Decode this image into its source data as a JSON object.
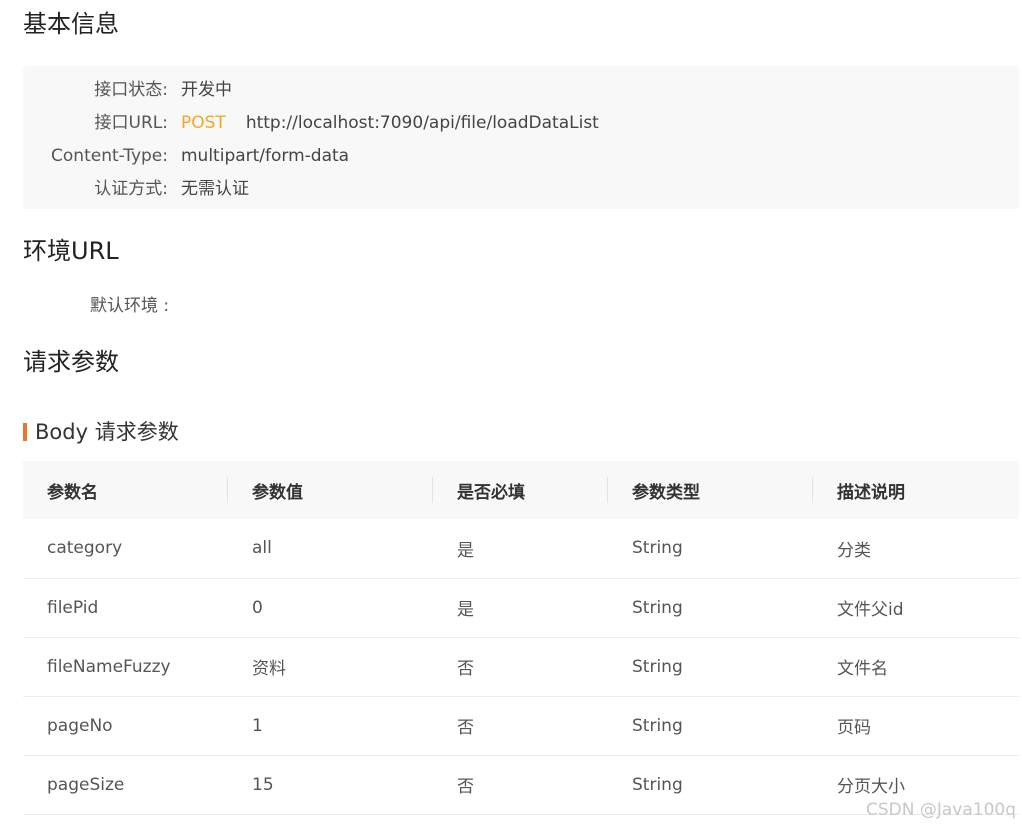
{
  "basic_info": {
    "title": "基本信息",
    "rows": [
      {
        "label": "接口状态:",
        "value": "开发中"
      },
      {
        "label": "接口URL:",
        "method": "POST",
        "value": "http://localhost:7090/api/file/loadDataList"
      },
      {
        "label": "Content-Type:",
        "value": "multipart/form-data"
      },
      {
        "label": "认证方式:",
        "value": "无需认证"
      }
    ]
  },
  "env": {
    "title": "环境URL",
    "default_label": "默认环境 :"
  },
  "request": {
    "title": "请求参数",
    "body_title": "Body 请求参数",
    "columns": [
      "参数名",
      "参数值",
      "是否必填",
      "参数类型",
      "描述说明"
    ],
    "rows": [
      [
        "category",
        "all",
        "是",
        "String",
        "分类"
      ],
      [
        "filePid",
        "0",
        "是",
        "String",
        "文件父id"
      ],
      [
        "fileNameFuzzy",
        "资料",
        "否",
        "String",
        "文件名"
      ],
      [
        "pageNo",
        "1",
        "否",
        "String",
        "页码"
      ],
      [
        "pageSize",
        "15",
        "否",
        "String",
        "分页大小"
      ]
    ]
  },
  "watermark": "CSDN @Java100q",
  "colors": {
    "method": "#f5a623",
    "accent_bar": "#e8772e"
  }
}
